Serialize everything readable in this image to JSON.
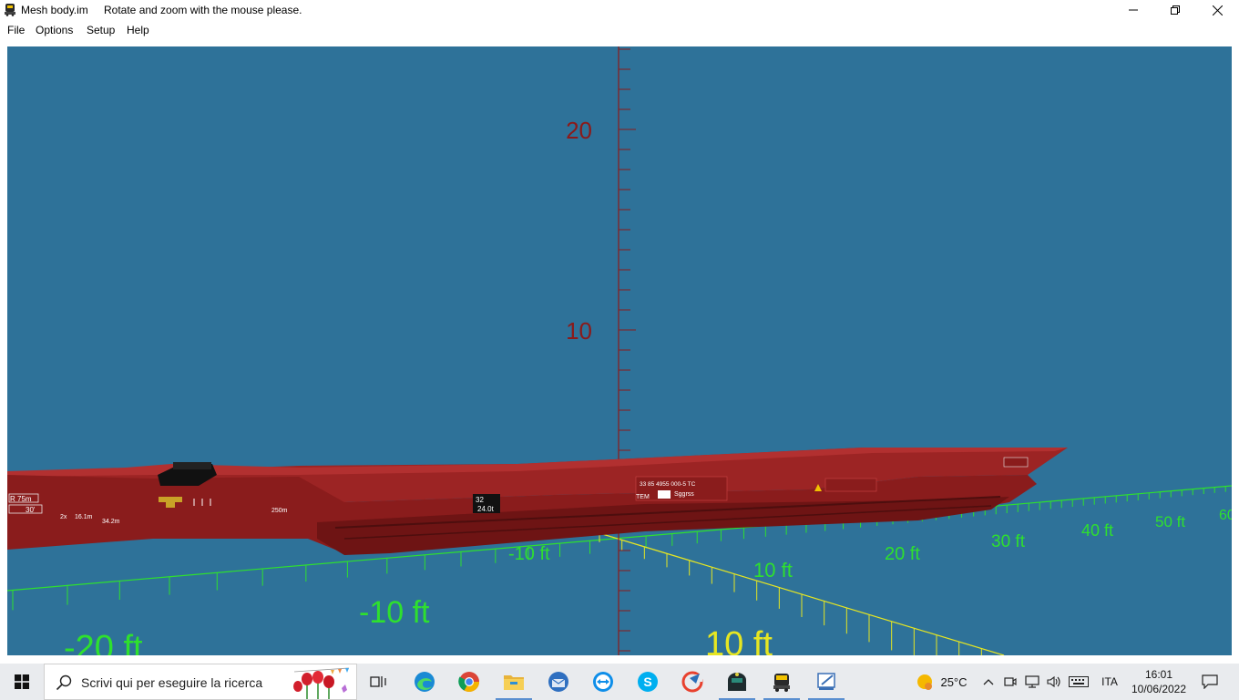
{
  "window": {
    "title": "Mesh body.im",
    "hint": "Rotate and zoom with the mouse please."
  },
  "menu": {
    "items": [
      "File",
      "Options",
      "Setup",
      "Help"
    ]
  },
  "viewport": {
    "background": "#2e7299",
    "vertical_axis_labels": [
      "20",
      "10"
    ],
    "green_axis_labels": [
      "-10 ft",
      "10 ft",
      "20 ft",
      "30 ft",
      "40 ft",
      "50 ft",
      "60",
      "-10 ft",
      "-20 ft"
    ],
    "yellow_axis_labels": [
      "10 ft"
    ],
    "wagon_markings": {
      "left_r": "R 75m",
      "left_deg": "30'",
      "len_a": "16.1m",
      "len_b": "34.2m",
      "small_2x": "2x",
      "radius": "250m",
      "weight_box_top": "32",
      "weight_box_bottom": "24.0t",
      "number": "33 85 4955 000-5 TC",
      "tem": "TEM",
      "type": "Sggrss"
    }
  },
  "taskbar": {
    "search_placeholder": "Scrivi qui per eseguire la ricerca",
    "apps": [
      "task-view-icon",
      "edge-icon",
      "chrome-icon",
      "file-explorer-icon",
      "thunderbird-icon",
      "teamviewer-icon",
      "skype-icon",
      "ccleaner-icon",
      "trainz-icon",
      "mesh-viewer-icon",
      "paint-icon"
    ],
    "weather_temp": "25°C",
    "language": "ITA",
    "time": "16:01",
    "date": "10/06/2022"
  }
}
